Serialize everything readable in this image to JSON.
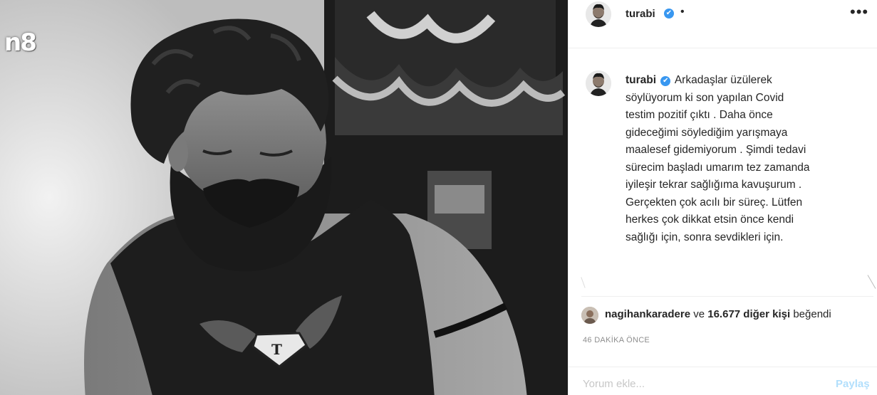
{
  "photo": {
    "channel_logo": "n8"
  },
  "header": {
    "username": "turabi",
    "verified_icon": "✔",
    "separator": "•",
    "more_icon": "•••"
  },
  "caption": {
    "username": "turabi",
    "verified_icon": "✔",
    "lines": [
      "Arkadaşlar üzülerek",
      "söylüyorum ki son yapılan Covid",
      "testim pozitif çıktı . Daha önce",
      "gideceğimi söylediğim yarışmaya",
      "maalesef gidemiyorum . Şimdi tedavi",
      "sürecim başladı umarım tez zamanda",
      "iyileşir tekrar sağlığıma kavuşurum .",
      "Gerçekten çok acılı bir süreç. Lütfen",
      "herkes çok dikkat etsin önce kendi",
      "sağlığı için, sonra sevdikleri için."
    ]
  },
  "likes": {
    "user": "nagihankaradere",
    "text_mid": " ve ",
    "count": "16.677 diğer kişi",
    "text_end": " beğendi"
  },
  "timestamp": "46 DAKİKA ÖNCE",
  "comment": {
    "placeholder": "Yorum ekle...",
    "post_label": "Paylaş"
  }
}
